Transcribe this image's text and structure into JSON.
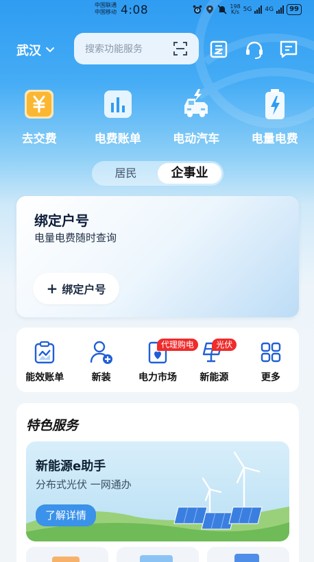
{
  "status_bar": {
    "carrier_1": "中国联通",
    "carrier_2": "中国移动",
    "time": "4:08",
    "net_speed_value": "198",
    "net_speed_unit": "K/s",
    "network_1": "5G",
    "network_2": "4G",
    "battery": "99"
  },
  "header": {
    "city": "武汉",
    "search_placeholder": "搜索功能服务"
  },
  "quick_actions": [
    {
      "label": "去交费",
      "icon": "yuan-icon"
    },
    {
      "label": "电费账单",
      "icon": "bar-chart-icon"
    },
    {
      "label": "电动汽车",
      "icon": "electric-car-icon"
    },
    {
      "label": "电量电费",
      "icon": "battery-bolt-icon"
    }
  ],
  "segmented": {
    "options": [
      "居民",
      "企事业"
    ],
    "selected": "企事业"
  },
  "bind_card": {
    "title": "绑定户号",
    "subtitle": "电量电费随时查询",
    "button_label": "绑定户号"
  },
  "services": [
    {
      "label": "能效账单",
      "icon": "efficiency-report-icon",
      "badge": ""
    },
    {
      "label": "新装",
      "icon": "new-user-icon",
      "badge": ""
    },
    {
      "label": "电力市场",
      "icon": "power-market-icon",
      "badge": "代理购电"
    },
    {
      "label": "新能源",
      "icon": "solar-panel-icon",
      "badge": "光伏"
    },
    {
      "label": "更多",
      "icon": "grid-more-icon",
      "badge": ""
    }
  ],
  "featured": {
    "title": "特色服务",
    "banner": {
      "title": "新能源e助手",
      "subtitle": "分布式光伏 一网通办",
      "button_label": "了解详情"
    }
  },
  "colors": {
    "brand_blue": "#2f9cf2",
    "badge_red": "#ef2b2b",
    "button_blue": "#3a92ea"
  }
}
